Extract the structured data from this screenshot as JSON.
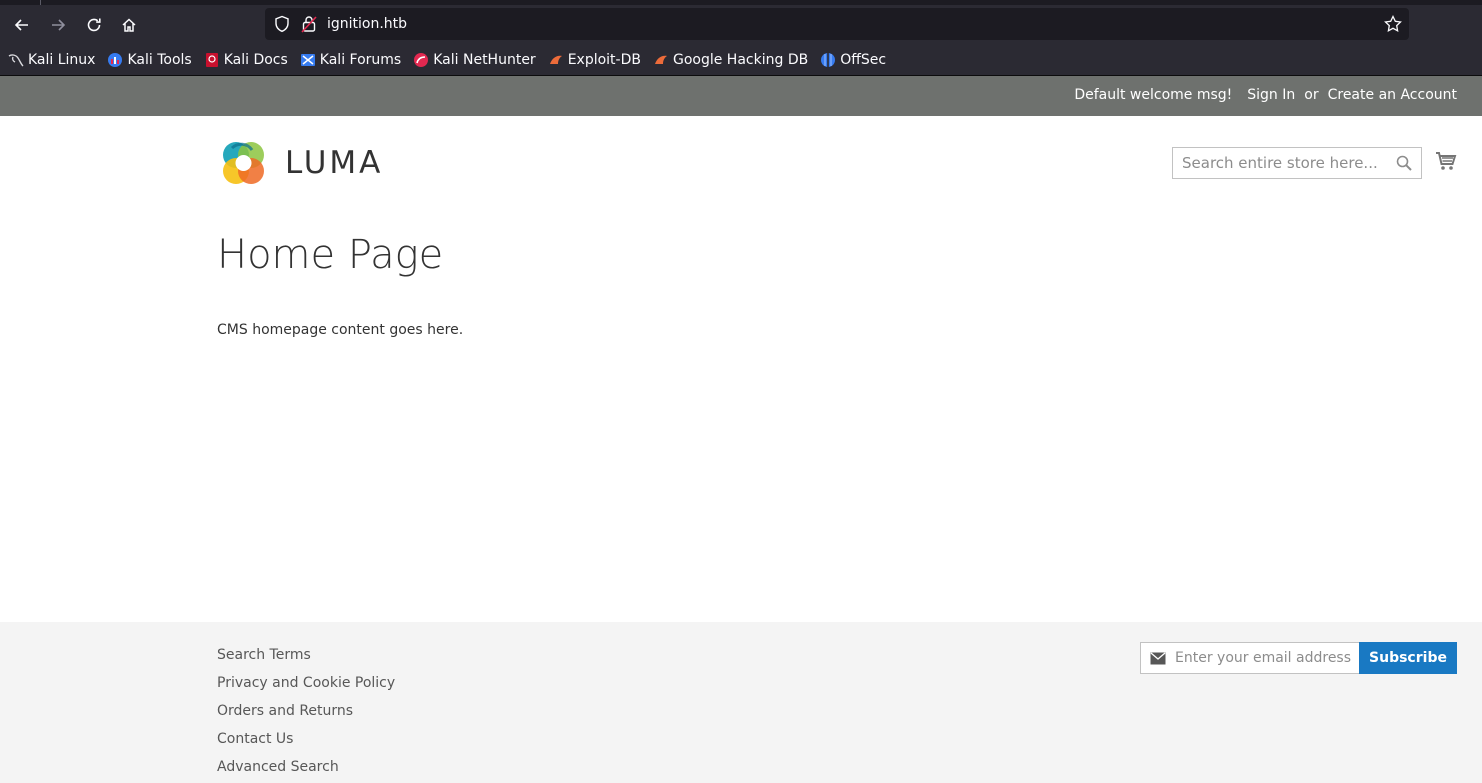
{
  "browser": {
    "url": "ignition.htb",
    "bookmarks": [
      {
        "label": "Kali Linux"
      },
      {
        "label": "Kali Tools"
      },
      {
        "label": "Kali Docs"
      },
      {
        "label": "Kali Forums"
      },
      {
        "label": "Kali NetHunter"
      },
      {
        "label": "Exploit-DB"
      },
      {
        "label": "Google Hacking DB"
      },
      {
        "label": "OffSec"
      }
    ]
  },
  "panel": {
    "welcome": "Default welcome msg!",
    "sign_in": "Sign In",
    "or": "or",
    "create_account": "Create an Account"
  },
  "header": {
    "logo_text": "LUMA",
    "search_placeholder": "Search entire store here..."
  },
  "main": {
    "title": "Home Page",
    "content": "CMS homepage content goes here."
  },
  "footer": {
    "links": [
      "Search Terms",
      "Privacy and Cookie Policy",
      "Orders and Returns",
      "Contact Us",
      "Advanced Search"
    ],
    "newsletter_placeholder": "Enter your email address",
    "subscribe_label": "Subscribe"
  },
  "colors": {
    "panel_bg": "#6e716e",
    "subscribe_bg": "#1979c3",
    "footer_bg": "#f4f4f4",
    "chrome_bg": "#2b2a33"
  }
}
